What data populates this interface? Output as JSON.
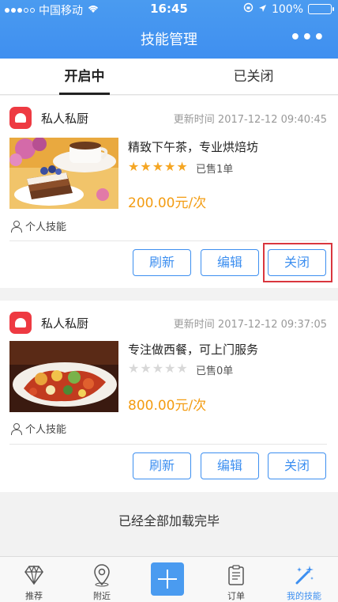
{
  "status_bar": {
    "carrier": "中国移动",
    "time": "16:45",
    "battery": "100%"
  },
  "navbar": {
    "title": "技能管理",
    "more": "•••"
  },
  "tabs": [
    {
      "label": "开启中",
      "active": true
    },
    {
      "label": "已关闭",
      "active": false
    }
  ],
  "cards": [
    {
      "store_name": "私人私厨",
      "update_time": "更新时间 2017-12-12 09:40:45",
      "title": "精致下午茶，专业烘焙坊",
      "rating": 5,
      "sold": "已售1单",
      "price": "200.00元/次",
      "skill_type": "个人技能",
      "buttons": {
        "refresh": "刷新",
        "edit": "编辑",
        "close": "关闭"
      }
    },
    {
      "store_name": "私人私厨",
      "update_time": "更新时间 2017-12-12 09:37:05",
      "title": "专注做西餐，可上门服务",
      "rating": 0,
      "sold": "已售0单",
      "price": "800.00元/次",
      "skill_type": "个人技能",
      "buttons": {
        "refresh": "刷新",
        "edit": "编辑",
        "close": "关闭"
      }
    }
  ],
  "footer_message": "已经全部加载完毕",
  "bottom_nav": [
    {
      "label": "推荐",
      "icon": "diamond-icon"
    },
    {
      "label": "附近",
      "icon": "location-pin-icon"
    },
    {
      "label": "",
      "icon": "plus-icon"
    },
    {
      "label": "订单",
      "icon": "order-list-icon"
    },
    {
      "label": "我的技能",
      "icon": "magic-wand-icon",
      "active": true
    }
  ],
  "colors": {
    "primary": "#3d8ff0",
    "price": "#f39c12",
    "star": "#f5a623",
    "logo": "#ee3a42",
    "highlight": "#d9363e"
  }
}
